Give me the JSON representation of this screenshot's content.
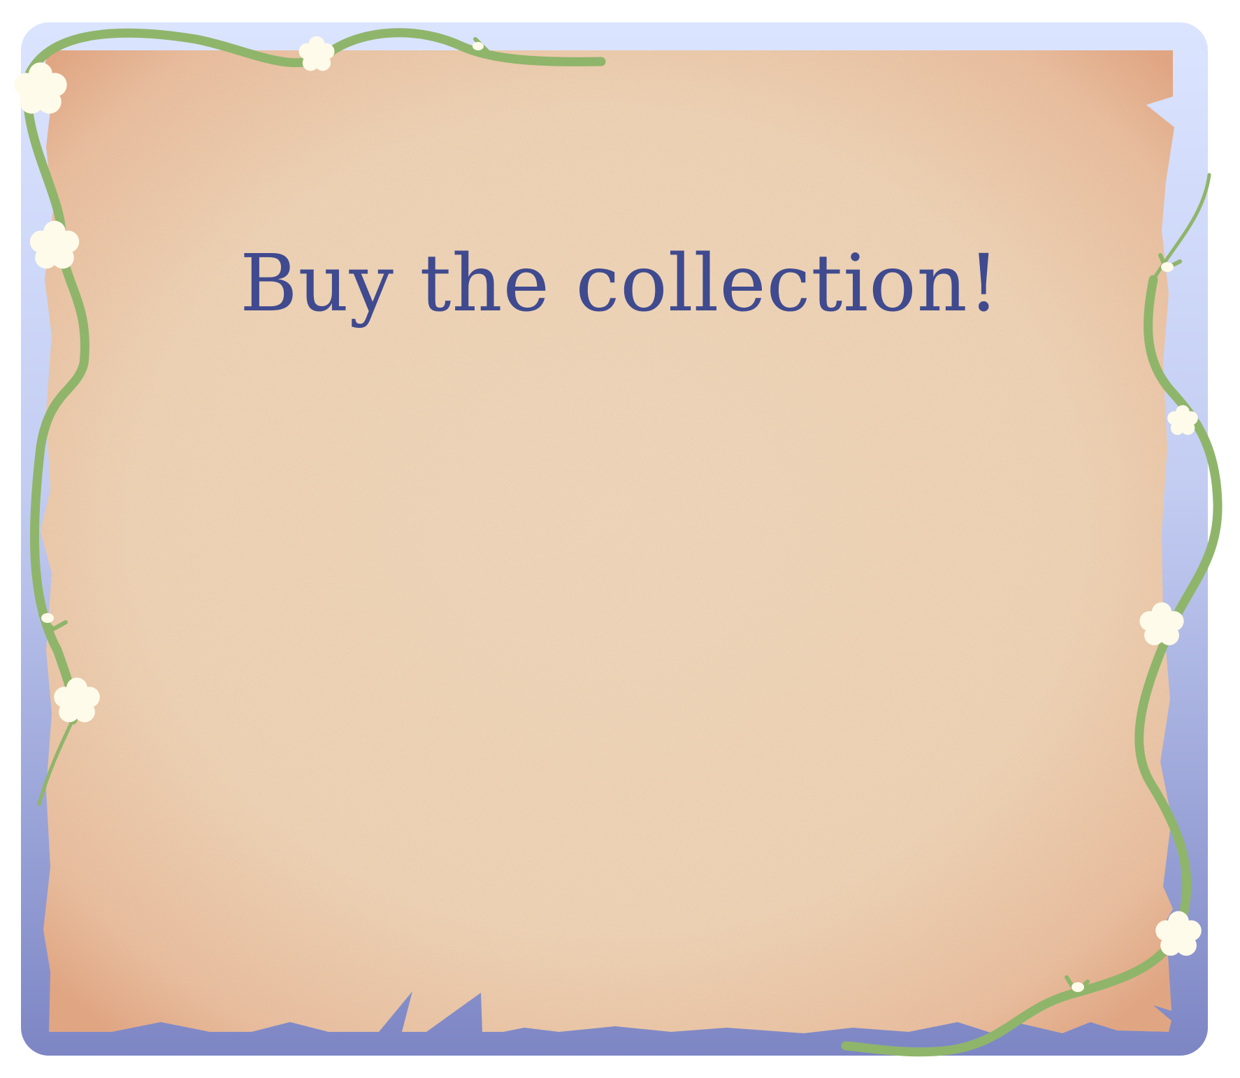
{
  "card": {
    "title": "Buy the collection!",
    "colors": {
      "title_text": "#3f4a8f",
      "frame_top": "#d9e3ff",
      "frame_bottom": "#7f87c4",
      "parchment_center": "#efd5b8",
      "parchment_edge": "#e6ae8e",
      "vine": "#8fb56b",
      "flower": "#fffbea"
    },
    "icons": [
      "vine-icon",
      "flower-icon"
    ]
  }
}
